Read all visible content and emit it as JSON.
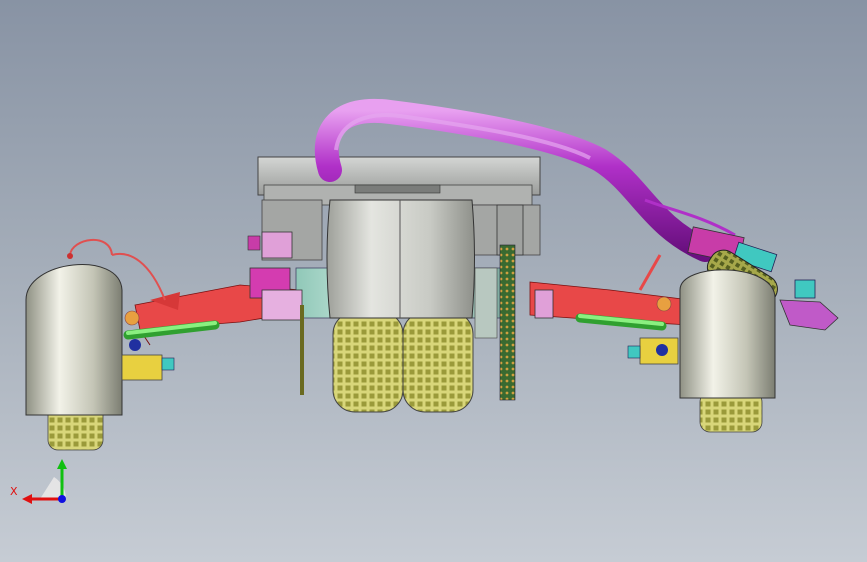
{
  "viewport": {
    "background_top": "#8893a4",
    "background_bottom": "#c6ccd4"
  },
  "colors": {
    "hose": "#b030c8",
    "hose_highlight": "#d98ae6",
    "arm": "#e84848",
    "tie_rod": "#62e060",
    "fender": "#d6d6c4",
    "tire": "#c9c86a",
    "tread": "#8a8a2c",
    "frame": "#c8cac8",
    "mount_pink": "#e0a0d8",
    "bracket_yellow": "#e8d040",
    "nut_blue": "#2030a0",
    "fitting_cyan": "#40c8c0",
    "drum": "#d0d2cc"
  },
  "triad": {
    "x_label": "X",
    "x_color": "#e01010",
    "y_color": "#10c010",
    "z_color": "#1010e0"
  },
  "parts": {
    "hose": "purple-hose",
    "fender_left": "left-fender",
    "fender_right": "right-fender",
    "tire_left": "left-tire",
    "tire_right": "right-tire",
    "center_tires": "center-dual-tires",
    "drum": "motor-drum",
    "arm_left": "left-control-arm",
    "arm_right": "right-control-arm"
  }
}
